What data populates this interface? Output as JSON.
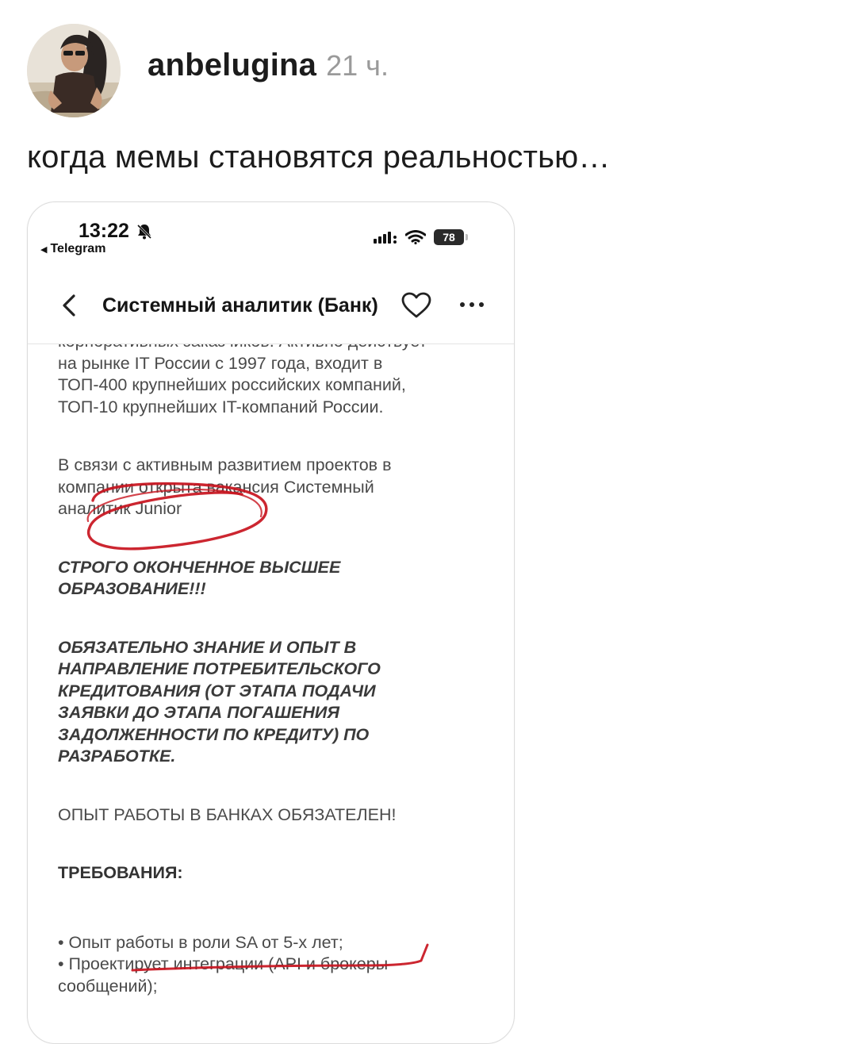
{
  "post": {
    "username": "anbelugina",
    "time": "21 ч.",
    "text": "когда мемы становятся реальностью…"
  },
  "screenshot": {
    "status_bar": {
      "time": "13:22",
      "back_app": "Telegram",
      "battery": "78"
    },
    "nav": {
      "title": "Системный аналитик (Банк)"
    },
    "content": {
      "intro_lines": [
        "корпоративных заказчиков. Активно действует",
        "на рынке IT России с 1997 года, входит в",
        "ТОП-400 крупнейших российских компаний,",
        "ТОП-10 крупнейших IT-компаний России."
      ],
      "vacancy_lines": [
        "В связи с активным развитием проектов в",
        "компании открыта вакансия Системный",
        "аналитик Junior"
      ],
      "strict_lines": [
        "СТРОГО ОКОНЧЕННОЕ ВЫСШЕЕ",
        "ОБРАЗОВАНИЕ!!!"
      ],
      "mandatory_lines": [
        "ОБЯЗАТЕЛЬНО ЗНАНИЕ И ОПЫТ В",
        "НАПРАВЛЕНИЕ ПОТРЕБИТЕЛЬСКОГО",
        "КРЕДИТОВАНИЯ (ОТ ЭТАПА ПОДАЧИ",
        "ЗАЯВКИ ДО ЭТАПА ПОГАШЕНИЯ",
        "ЗАДОЛЖЕННОСТИ ПО КРЕДИТУ) ПО",
        "РАЗРАБОТКЕ."
      ],
      "banks": "ОПЫТ РАБОТЫ В БАНКАХ ОБЯЗАТЕЛЕН!",
      "requirements_heading": "ТРЕБОВАНИЯ:",
      "requirements_lines": [
        "• Опыт работы в роли SA от 5-х лет;",
        "• Проектирует интеграции (API и брокеры",
        "сообщений);"
      ]
    },
    "annotation_color": "#c8141e"
  }
}
